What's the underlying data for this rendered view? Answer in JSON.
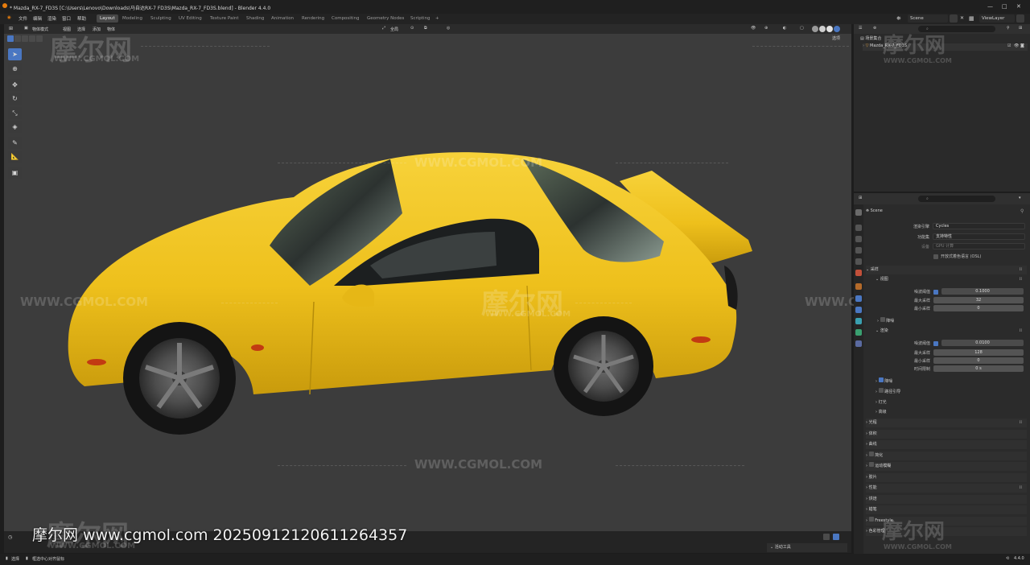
{
  "titlebar": {
    "title": "* Mazda_RX-7_FD3S [C:\\Users\\Lenovo\\Downloads\\马自达RX-7 FD3S\\Mazda_RX-7_FD3S.blend] - Blender 4.4.0",
    "minimize": "—",
    "maximize": "□",
    "close": "✕"
  },
  "menubar": {
    "items": [
      "文件",
      "编辑",
      "渲染",
      "窗口",
      "帮助"
    ],
    "workspaces": [
      "Layout",
      "Modeling",
      "Sculpting",
      "UV Editing",
      "Texture Paint",
      "Shading",
      "Animation",
      "Rendering",
      "Compositing",
      "Geometry Nodes",
      "Scripting"
    ],
    "add_workspace": "+",
    "scene_label": "Scene",
    "view_layer_label": "ViewLayer"
  },
  "viewport": {
    "mode": "物体模式",
    "menus": [
      "视图",
      "选择",
      "添加",
      "物体"
    ],
    "transform_orientation": "全局",
    "shading_label": "选项",
    "tools": [
      "select-box",
      "cursor",
      "move",
      "rotate",
      "scale",
      "transform",
      "annotate",
      "measure",
      "add-cube"
    ]
  },
  "watermark": {
    "logo_text": "摩尔网",
    "url_text": "WWW.CGMOL.COM",
    "caption": "摩尔网 www.cgmol.com 20250912120611264357"
  },
  "outliner": {
    "search_placeholder": "",
    "root": "场景集合",
    "items": [
      "Mazda_RX-7_FD3S"
    ]
  },
  "properties": {
    "search_placeholder": "",
    "context": "Scene",
    "render_engine_label": "渲染引擎",
    "render_engine_value": "Cycles",
    "feature_set_label": "功能集",
    "feature_set_value": "支持特性",
    "device_label": "设备",
    "device_value": "GPU 计算",
    "osl_label": "开放式着色语言 (OSL)",
    "sections": {
      "sampling": "采样",
      "viewport": "视图",
      "noise_threshold_label": "噪波阈值",
      "viewport_noise_threshold": "0.1000",
      "max_samples_label": "最大采样",
      "viewport_max_samples": "32",
      "min_samples_label": "最小采样",
      "viewport_min_samples": "0",
      "denoise": "降噪",
      "render": "渲染",
      "render_noise_threshold": "0.0100",
      "render_max_samples": "128",
      "render_min_samples": "0",
      "time_limit_label": "时间限制",
      "render_time_limit": "0 s",
      "denoise2": "降噪",
      "path_guiding": "路径引导",
      "lights": "灯光",
      "advanced": "高级",
      "light_paths": "光程",
      "volumes": "体积",
      "curves": "曲线",
      "simplify": "简化",
      "motion_blur": "运动模糊",
      "film": "胶片",
      "performance": "性能",
      "bake": "烘焙",
      "grease_pencil": "蜡笔",
      "freestyle": "Freestyle",
      "color_management": "色彩管理"
    }
  },
  "timeline": {
    "active_tool": "活动工具"
  },
  "statusbar": {
    "left_label": "选择",
    "hint": "框选中心对齐鼠标",
    "version": "4.4.0"
  },
  "colors": {
    "accent": "#4a77c2",
    "car_body": "#f2c21a",
    "viewport_bg": "#3c3c3c"
  }
}
